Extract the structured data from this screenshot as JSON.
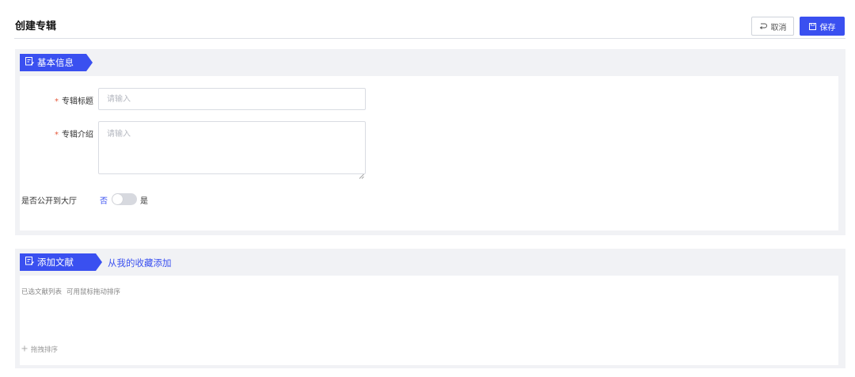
{
  "header": {
    "title": "创建专辑",
    "cancel_label": "取消",
    "save_label": "保存"
  },
  "basic_info": {
    "section_label": "基本信息",
    "title_field": {
      "label": "专辑标题",
      "required_mark": "*",
      "placeholder": "请输入",
      "value": ""
    },
    "intro_field": {
      "label": "专辑介绍",
      "required_mark": "*",
      "placeholder": "请输入",
      "value": ""
    },
    "public_toggle": {
      "label": "是否公开到大厅",
      "off_label": "否",
      "on_label": "是",
      "checked": false
    }
  },
  "add_docs": {
    "section_label": "添加文献",
    "from_favorites_link": "从我的收藏添加",
    "selected_list_label": "已选文献列表",
    "selected_list_hint": "可用鼠标拖动排序",
    "drag_sort_label": "拖拽排序"
  },
  "colors": {
    "primary": "#3a50f0",
    "section_bg": "#f1f2f5",
    "required": "#e55a3c"
  }
}
